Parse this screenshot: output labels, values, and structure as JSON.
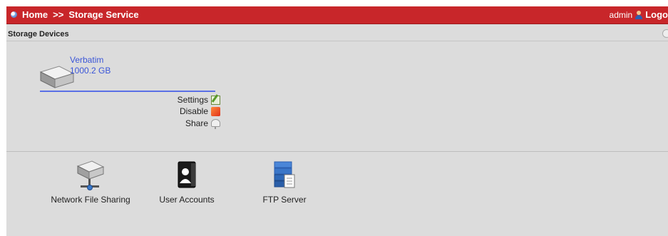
{
  "topbar": {
    "breadcrumb": {
      "home": "Home",
      "separator": ">>",
      "current": "Storage Service"
    },
    "user": "admin",
    "logout_label": "Logo"
  },
  "section": {
    "title": "Storage Devices"
  },
  "device": {
    "name": "Verbatim",
    "size": "1000.2 GB",
    "icon": "hard-drive-icon"
  },
  "actions": {
    "settings": "Settings",
    "disable": "Disable",
    "share": "Share"
  },
  "apps": [
    {
      "label": "Network File Sharing",
      "icon": "network-drive-icon"
    },
    {
      "label": "User Accounts",
      "icon": "user-accounts-icon"
    },
    {
      "label": "FTP Server",
      "icon": "ftp-server-icon"
    }
  ],
  "colors": {
    "topbar": "#c8262a",
    "background": "#dcdcdc",
    "link": "#3b56d8",
    "usage_bar": "#5a6fe6"
  }
}
